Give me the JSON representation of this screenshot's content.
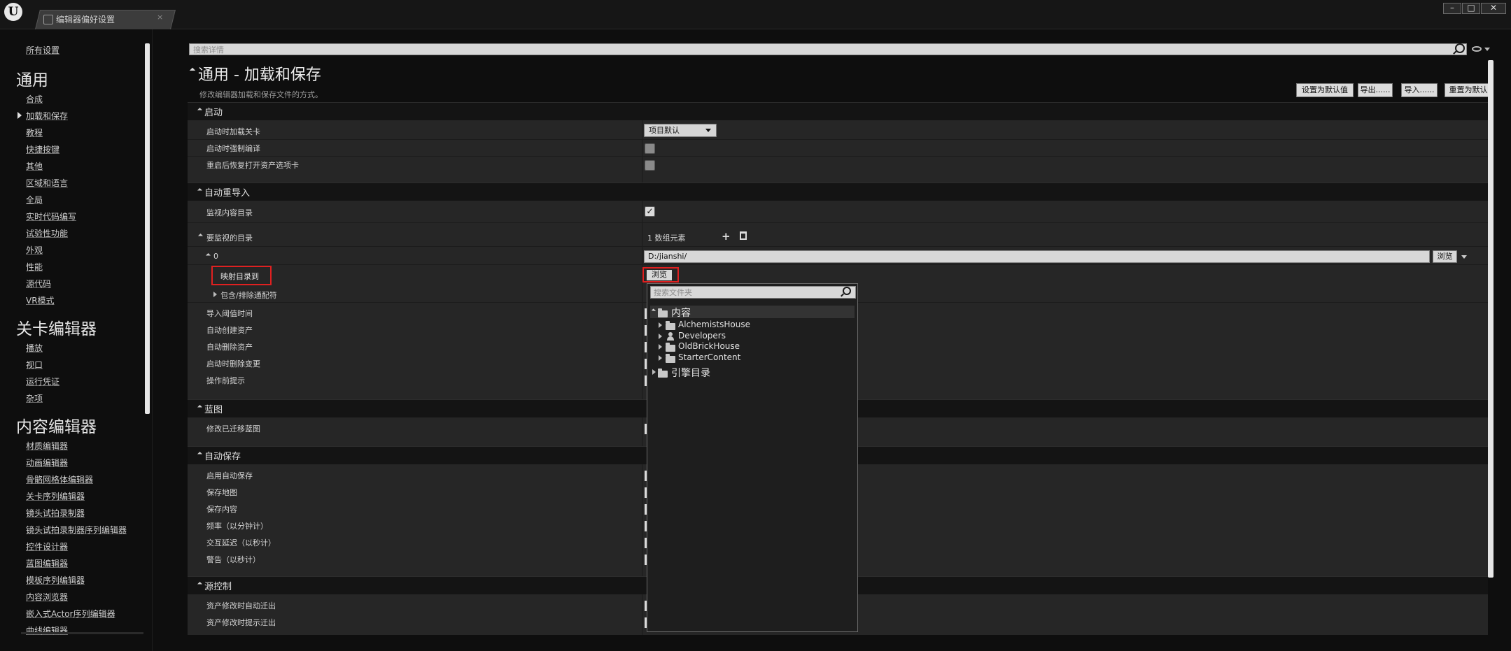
{
  "titlebar": {
    "logo": "U",
    "tab_label": "编辑器偏好设置",
    "tab_close": "×",
    "minimize": "–",
    "maximize": "□",
    "close": "✕"
  },
  "sidebar": {
    "all_settings": "所有设置",
    "sections": [
      {
        "heading": "通用",
        "items": [
          "合成",
          "加载和保存",
          "教程",
          "快捷按键",
          "其他",
          "区域和语言",
          "全局",
          "实时代码编写",
          "试验性功能",
          "外观",
          "性能",
          "源代码",
          "VR模式"
        ]
      },
      {
        "heading": "关卡编辑器",
        "items": [
          "播放",
          "视口",
          "运行凭证",
          "杂项"
        ]
      },
      {
        "heading": "内容编辑器",
        "items": [
          "材质编辑器",
          "动画编辑器",
          "骨骼网格体编辑器",
          "关卡序列编辑器",
          "镜头试拍录制器",
          "镜头试拍录制器序列编辑器",
          "控件设计器",
          "蓝图编辑器",
          "模板序列编辑器",
          "内容浏览器",
          "嵌入式Actor序列编辑器",
          "曲线编辑器"
        ]
      }
    ]
  },
  "search": {
    "placeholder": "搜索详情"
  },
  "page": {
    "title": "通用 - 加载和保存",
    "description": "修改编辑器加载和保存文件的方式。",
    "buttons": [
      "设置为默认值",
      "导出......",
      "导入......",
      "重置为默认"
    ]
  },
  "categories": {
    "startup": "启动",
    "auto_reimport": "自动重导入",
    "blueprint": "蓝图",
    "autosave": "自动保存",
    "source_control": "源控制"
  },
  "props": {
    "load_level_at_startup": "启动时加载关卡",
    "load_level_value": "项目默认",
    "force_compile_at_startup": "启动时强制编译",
    "restore_asset_tabs": "重启后恢复打开资产选项卡",
    "monitor_content_dirs": "监视内容目录",
    "dirs_to_monitor": "要监视的目录",
    "array_count": "1 数组元素",
    "element_index": "0",
    "path_value": "D:/jianshi/",
    "browse": "浏览",
    "map_dir_to": "映射目录到",
    "include_exclude": "包含/排除通配符",
    "import_threshold": "导入阈值时间",
    "auto_create_assets": "自动创建资产",
    "auto_delete_assets": "自动删除资产",
    "detect_changes_on_startup": "启动时删除变更",
    "prompt_before_action": "操作前提示",
    "modify_migrated_bp": "修改已迁移蓝图",
    "enable_autosave": "启用自动保存",
    "save_maps": "保存地图",
    "save_content": "保存内容",
    "frequency": "频率（以分钟计）",
    "interaction_delay": "交互延迟（以秒计）",
    "warning": "警告（以秒计）",
    "auto_checkout": "资产修改时自动迁出",
    "prompt_checkout": "资产修改时提示迁出"
  },
  "picker": {
    "search_placeholder": "搜索文件夹",
    "root_content": "内容",
    "folders": [
      "AlchemistsHouse",
      "Developers",
      "OldBrickHouse",
      "StarterContent"
    ],
    "engine_root": "引擎目录"
  }
}
